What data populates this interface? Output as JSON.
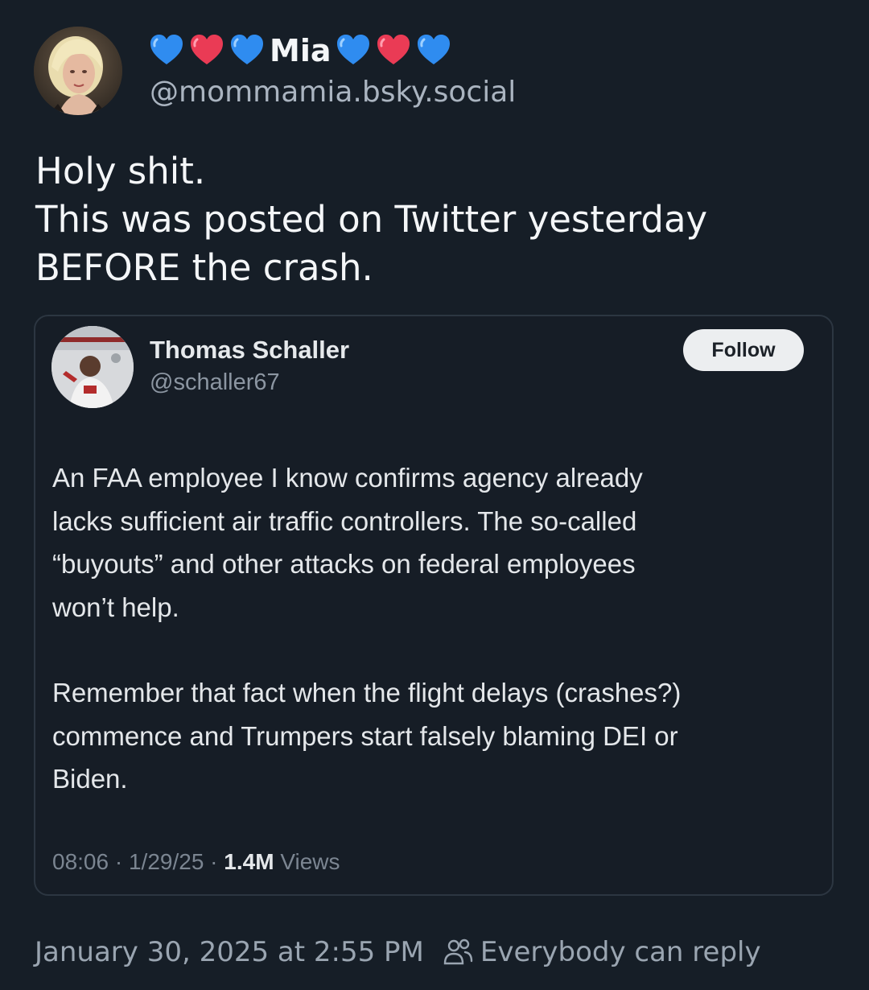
{
  "post": {
    "display_name": "Mia",
    "name_decoration": {
      "left_emoji": [
        "blue-heart",
        "red-heart",
        "blue-heart"
      ],
      "right_emoji": [
        "blue-heart",
        "red-heart",
        "blue-heart"
      ],
      "colors": {
        "blue_heart": "#2f8cf0",
        "red_heart": "#ea3b55"
      }
    },
    "handle": "@mommamia.bsky.social",
    "text_lines": [
      "Holy shit.",
      "This was posted on Twitter yesterday",
      "BEFORE the crash."
    ],
    "timestamp": "January 30, 2025 at 2:55 PM",
    "reply_setting": "Everybody can reply",
    "reply_icon": "people-icon"
  },
  "embed": {
    "author_name": "Thomas Schaller",
    "author_handle": "@schaller67",
    "follow_label": "Follow",
    "paragraph1_lines": [
      "An FAA employee I know confirms agency already",
      "lacks sufficient air traffic controllers. The so-called",
      "“buyouts” and other attacks on federal employees",
      "won’t help."
    ],
    "paragraph2_lines": [
      "Remember that fact when the flight delays (crashes?)",
      "commence and Trumpers start falsely blaming DEI or",
      "Biden."
    ],
    "meta": {
      "time": "08:06",
      "separator": "·",
      "date": "1/29/25",
      "views_count": "1.4M",
      "views_label": "Views"
    }
  },
  "colors": {
    "background": "#161e27",
    "text_primary": "#f4f6f8",
    "text_secondary": "#aab4c0",
    "embed_border": "#2c3641"
  }
}
